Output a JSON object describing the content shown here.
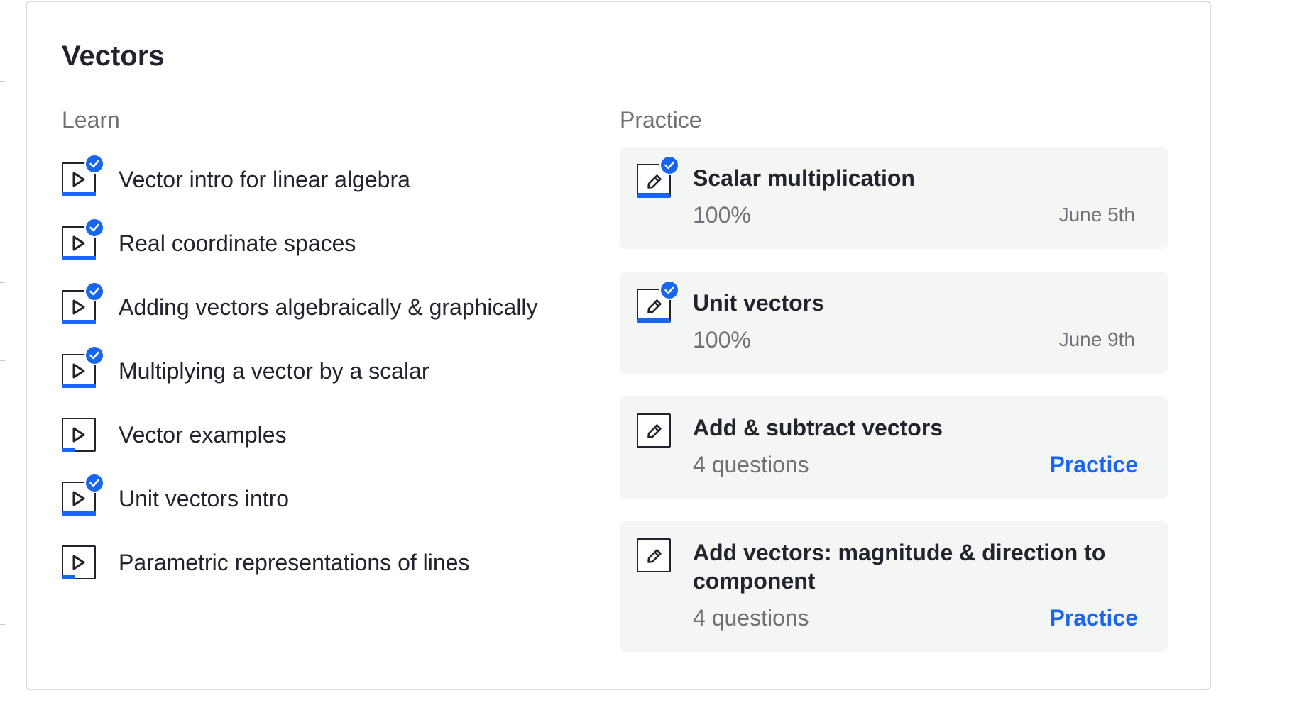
{
  "unit": {
    "title": "Vectors"
  },
  "learn": {
    "heading": "Learn",
    "items": [
      {
        "label": "Vector intro for linear algebra",
        "completed": true,
        "progress": 1.0
      },
      {
        "label": "Real coordinate spaces",
        "completed": true,
        "progress": 1.0
      },
      {
        "label": "Adding vectors algebraically & graphically",
        "completed": true,
        "progress": 1.0
      },
      {
        "label": "Multiplying a vector by a scalar",
        "completed": true,
        "progress": 1.0
      },
      {
        "label": "Vector examples",
        "completed": false,
        "progress": 0.4
      },
      {
        "label": "Unit vectors intro",
        "completed": true,
        "progress": 1.0
      },
      {
        "label": "Parametric representations of lines",
        "completed": false,
        "progress": 0.4
      }
    ]
  },
  "practice": {
    "heading": "Practice",
    "items": [
      {
        "title": "Scalar multiplication",
        "meta": "100%",
        "date": "June 5th",
        "completed": true
      },
      {
        "title": "Unit vectors",
        "meta": "100%",
        "date": "June 9th",
        "completed": true
      },
      {
        "title": "Add & subtract vectors",
        "meta": "4 questions",
        "action": "Practice",
        "completed": false
      },
      {
        "title": "Add vectors: magnitude & direction to component",
        "meta": "4 questions",
        "action": "Practice",
        "completed": false
      }
    ]
  },
  "icons": {
    "learn_item": "video-play-icon",
    "practice_item": "pencil-icon",
    "completed": "checkmark-icon"
  },
  "colors": {
    "accent": "#1865f2",
    "text": "#21242c",
    "muted": "#6f7177",
    "card_bg": "#f4f5f5",
    "border": "#dadbdf"
  }
}
